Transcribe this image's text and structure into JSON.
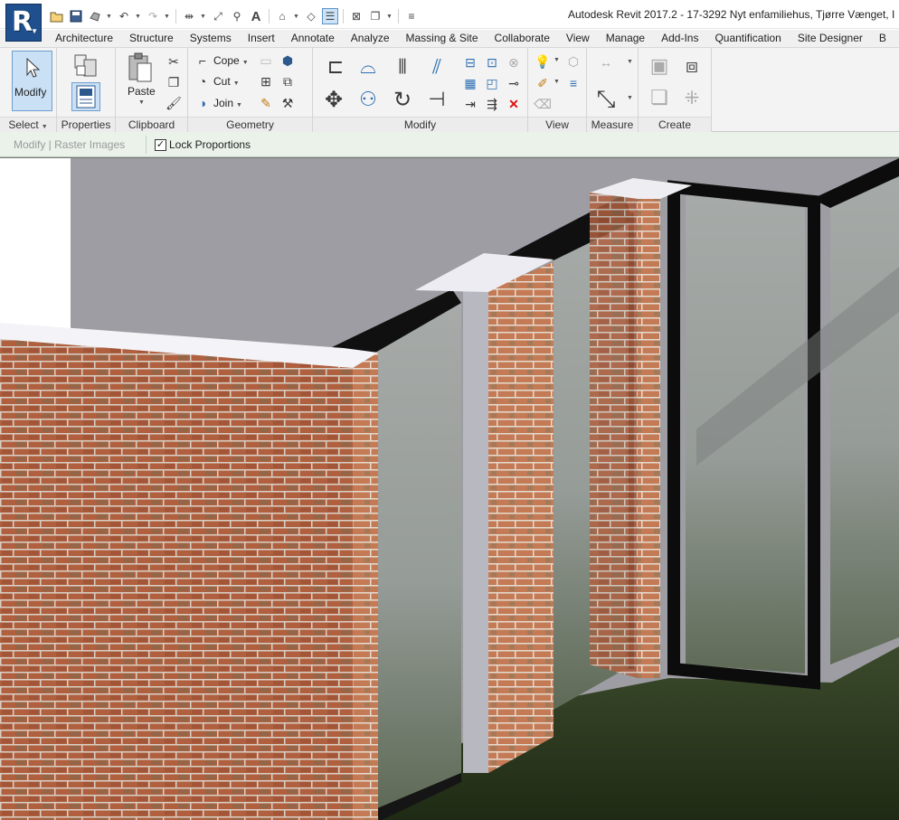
{
  "app": {
    "logo_letter": "R",
    "window_title": "Autodesk Revit 2017.2 -      17-3292 Nyt enfamiliehus, Tjørre Vænget, I"
  },
  "quick_access": {
    "icons": [
      "open-icon",
      "save-icon",
      "sync-icon",
      "undo-icon",
      "redo-icon",
      "measure-icon",
      "dimension-icon",
      "tag-icon",
      "text-icon",
      "3d-view-icon",
      "section-icon",
      "thin-lines-icon",
      "close-hidden-icon",
      "switch-windows-icon",
      "customize-icon"
    ],
    "text_button": "A"
  },
  "tabs": [
    "Architecture",
    "Structure",
    "Systems",
    "Insert",
    "Annotate",
    "Analyze",
    "Massing & Site",
    "Collaborate",
    "View",
    "Manage",
    "Add-Ins",
    "Quantification",
    "Site Designer",
    "B"
  ],
  "ribbon": {
    "select": {
      "modify_label": "Modify",
      "panel_label": "Select"
    },
    "properties": {
      "panel_label": "Properties"
    },
    "clipboard": {
      "paste_label": "Paste",
      "panel_label": "Clipboard"
    },
    "geometry": {
      "cope_label": "Cope",
      "cut_label": "Cut",
      "join_label": "Join",
      "panel_label": "Geometry"
    },
    "modify": {
      "panel_label": "Modify"
    },
    "view": {
      "panel_label": "View"
    },
    "measure": {
      "panel_label": "Measure"
    },
    "create": {
      "panel_label": "Create"
    }
  },
  "options_bar": {
    "context_label": "Modify | Raster Images",
    "lock_proportions_label": "Lock Proportions",
    "lock_proportions_checked": true,
    "check_mark": "✓"
  },
  "colors": {
    "revit_blue": "#1f4f8c",
    "brick": "#a85a3a",
    "options_bar_bg": "#eaf2ea",
    "ground": "#2f3a22"
  }
}
